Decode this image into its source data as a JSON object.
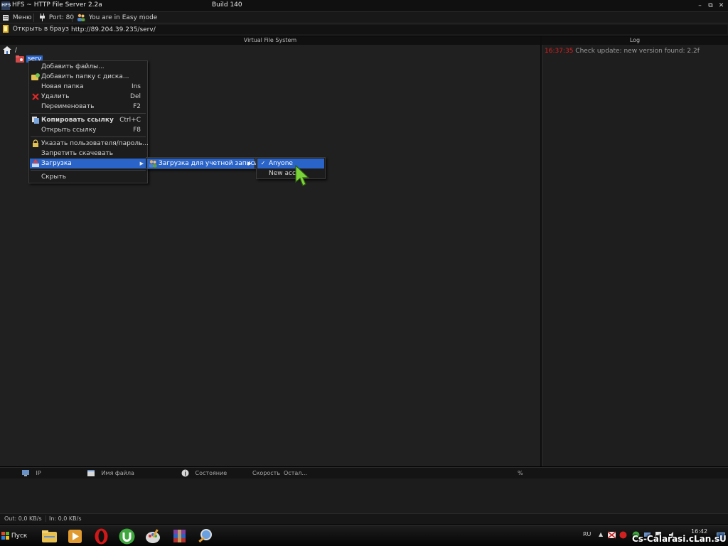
{
  "window": {
    "title": "HFS ~ HTTP File Server 2.2a",
    "build": "Build 140",
    "logo_text": "HFS"
  },
  "toolbar": {
    "menu_label": "Меню",
    "port_label": "Port: 80",
    "mode_label": "You are in Easy mode",
    "open_browser_label": "Открыть в браузере",
    "url_value": "http://89.204.39.235/serv/"
  },
  "panels": {
    "vfs_title": "Virtual File System",
    "log_title": "Log"
  },
  "tree": {
    "root_label": "/",
    "folder_label": "serv"
  },
  "log": {
    "time": "16:37:35",
    "message": "Check update: new version found: 2.2f"
  },
  "context_menu": {
    "items": [
      {
        "label": "Добавить файлы...",
        "shortcut": ""
      },
      {
        "label": "Добавить папку с диска...",
        "shortcut": ""
      },
      {
        "label": "Новая папка",
        "shortcut": "Ins"
      },
      {
        "label": "Удалить",
        "shortcut": "Del"
      },
      {
        "label": "Переименовать",
        "shortcut": "F2"
      },
      {
        "label": "Копировать ссылку",
        "shortcut": "Ctrl+C"
      },
      {
        "label": "Открыть ссылку",
        "shortcut": "F8"
      },
      {
        "label": "Указать пользователя/пароль...",
        "shortcut": ""
      },
      {
        "label": "Запретить скачевать",
        "shortcut": ""
      },
      {
        "label": "Загрузка",
        "shortcut": ""
      },
      {
        "label": "Скрыть",
        "shortcut": ""
      }
    ],
    "active_item": "Загрузка"
  },
  "submenu": {
    "item": "Загрузка для учетной записи"
  },
  "submenu2": {
    "items": [
      "Anyone",
      "New acco"
    ],
    "checked": "Anyone"
  },
  "connections": {
    "columns": [
      "IP",
      "Имя файла",
      "Состояние",
      "Скорость",
      "Остал...",
      "%"
    ]
  },
  "status": {
    "out": "Out: 0,0 KB/s",
    "in": "In: 0,0 KB/s"
  },
  "taskbar": {
    "start_label": "Пуск",
    "lang": "RU",
    "clock": "16:42"
  },
  "watermark": "Cs-Calarasi.cLan.sU",
  "colors": {
    "selection": "#2a64c8",
    "log_time": "#e02020",
    "cursor": "#7bd33a"
  }
}
